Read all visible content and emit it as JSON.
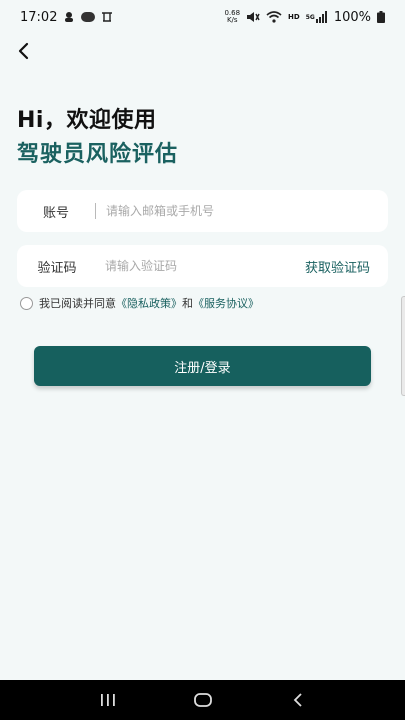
{
  "status_bar": {
    "time": "17:02",
    "net_speed_value": "0.68",
    "net_speed_unit": "K/s",
    "network_type": "HD",
    "signal_gen": "5G",
    "battery": "100%"
  },
  "header": {
    "greeting": "Hi，欢迎使用",
    "subtitle": "驾驶员风险评估"
  },
  "form": {
    "account_label": "账号",
    "account_placeholder": "请输入邮箱或手机号",
    "code_label": "验证码",
    "code_placeholder": "请输入验证码",
    "get_code_label": "获取验证码"
  },
  "agreement": {
    "prefix": "我已阅读并同意",
    "privacy_link": "《隐私政策》",
    "and": "和",
    "service_link": "《服务协议》"
  },
  "login_button_label": "注册/登录",
  "colors": {
    "accent": "#1a6160",
    "button": "#16605e",
    "background": "#f3f8f8"
  }
}
